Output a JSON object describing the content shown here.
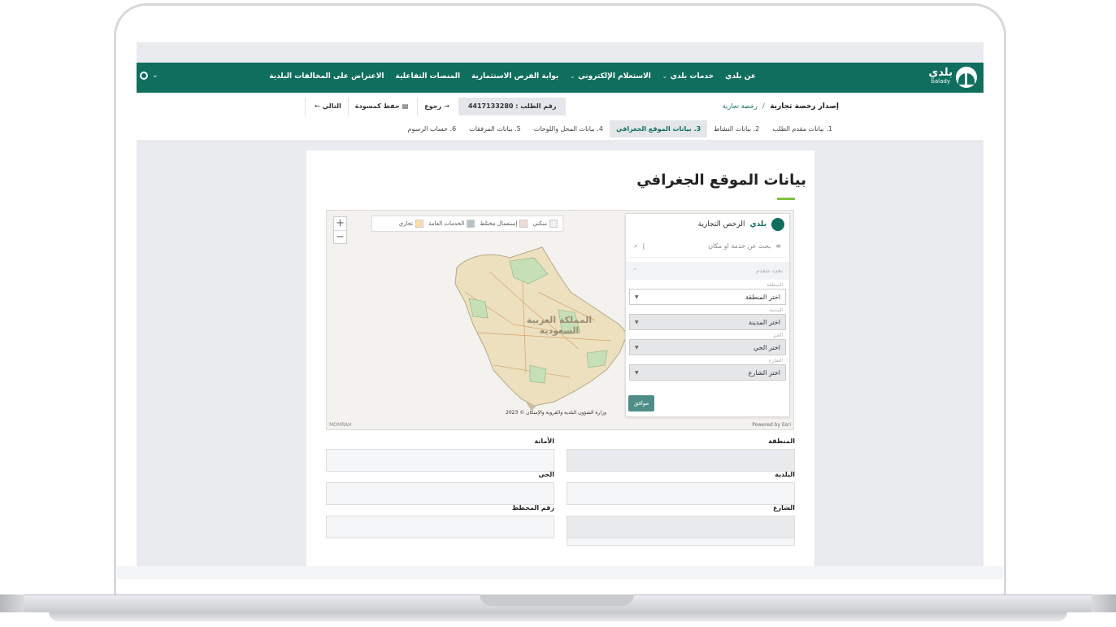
{
  "nav": {
    "logo_text": "بلدي",
    "logo_sub": "balady",
    "items": [
      {
        "label": "عن بلدي",
        "has_chevron": false
      },
      {
        "label": "خدمات بلدي",
        "has_chevron": true
      },
      {
        "label": "الاستعلام الإلكتروني",
        "has_chevron": true
      },
      {
        "label": "بوابة الفرص الاستثمارية",
        "has_chevron": false
      },
      {
        "label": "المنصات التفاعلية",
        "has_chevron": false
      },
      {
        "label": "الاعتراض على المخالفات البلدية",
        "has_chevron": false
      }
    ],
    "user_chevron": "⌄"
  },
  "header": {
    "breadcrumb_main": "إصدار رخصة تجارية",
    "breadcrumb_sub": "رخصة تجارية",
    "request_label": "رقم الطلب : 4417133280",
    "back_label": "رجوع",
    "save_draft_label": "حفظ كمسودة",
    "next_label": "التالي"
  },
  "steps": [
    {
      "label": "1. بيانات مقدم الطلب",
      "active": false
    },
    {
      "label": "2. بيانات النشاط",
      "active": false
    },
    {
      "label": "3. بيانات الموقع الجغرافي",
      "active": true
    },
    {
      "label": "4. بيانات المحل واللوحات",
      "active": false
    },
    {
      "label": "5. بيانات المرفقات",
      "active": false
    },
    {
      "label": "6. حساب الرسوم",
      "active": false
    }
  ],
  "card": {
    "title": "بيانات الموقع الجغرافي"
  },
  "map": {
    "legend": [
      {
        "label": "سكني",
        "color": "#f0f0f0"
      },
      {
        "label": "إستعمال مختلط",
        "color": "#f3d9d6"
      },
      {
        "label": "الخدمات العامة",
        "color": "#b7c3c6"
      },
      {
        "label": "تجاري",
        "color": "#f7dfae"
      }
    ],
    "country_label_1": "المملكة العربية",
    "country_label_2": "السعودية",
    "credit": "وزارة الشؤون البلدية والقروية والإسكان © 2023",
    "left_credit": "MOMRAH",
    "right_credit": "Powered by Esri",
    "zoom_in": "+",
    "zoom_out": "−"
  },
  "panel": {
    "title": "الرخص التجارية",
    "logo_text": "بلدي",
    "search_placeholder": "بحث عن خدمة او مكان",
    "advanced_label": "بحث متقدم",
    "region_label": "المنطقة",
    "region_value": "اختر المنطقة",
    "city_label": "المدينة",
    "city_value": "اختر المدينة",
    "district_label": "الحي",
    "district_value": "اختر الحي",
    "street_label": "الشارع",
    "street_value": "اختر الشارع",
    "ok_label": "موافق"
  },
  "form": {
    "region": "المنطقة",
    "amana": "الأمانة",
    "baladiya": "البلدية",
    "district": "الحي",
    "street": "الشارع",
    "plan_number": "رقم المخطط"
  }
}
